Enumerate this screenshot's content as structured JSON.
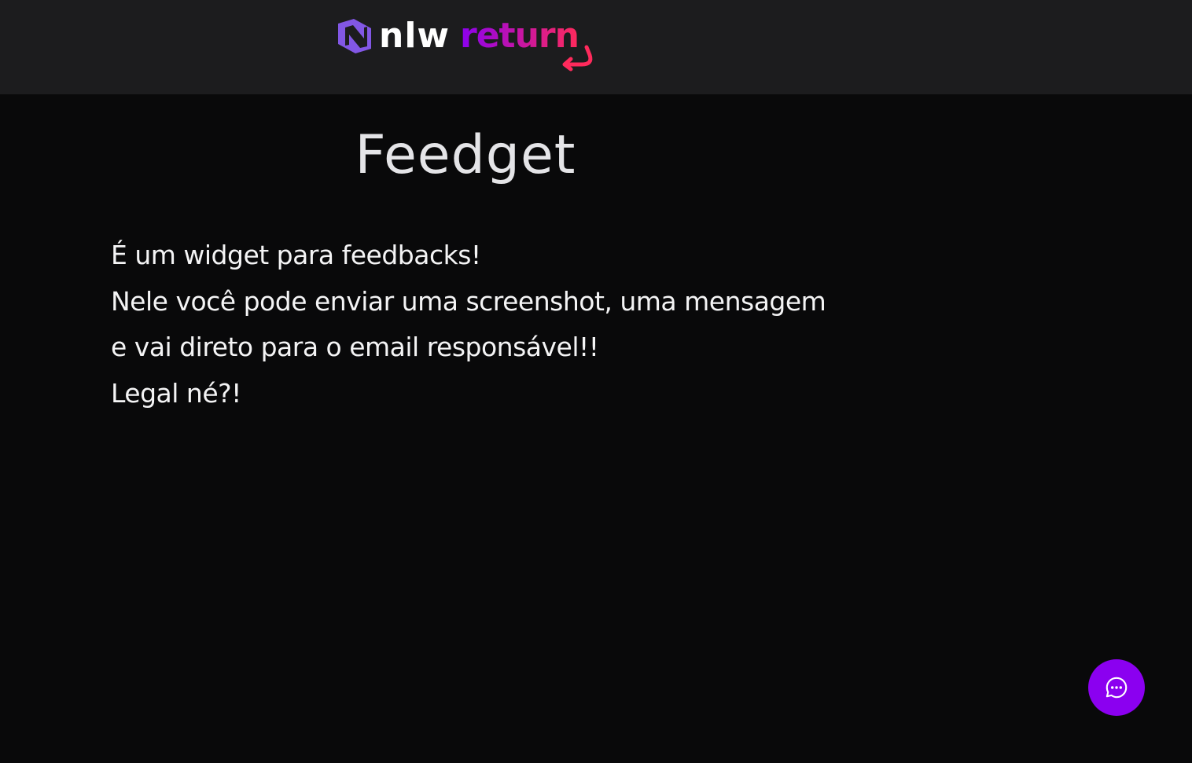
{
  "header": {
    "logo": {
      "text_primary": "nlw",
      "text_secondary": "return",
      "icon": "nlw-mark-icon",
      "colors": {
        "mark": "#8257e5",
        "primary_text": "#ffffff",
        "gradient_start": "#8b00f0",
        "gradient_end": "#ff2a5c"
      }
    },
    "background": "#1c1c1e"
  },
  "main": {
    "title": "Feedget",
    "description_lines": [
      "É um widget para feedbacks!",
      "Nele você pode enviar uma screenshot, uma mensagem",
      "e vai direto para o email responsável!!",
      "Legal né?!"
    ],
    "background": "#09090a"
  },
  "widget_button": {
    "icon": "chat-bubble-dots-icon",
    "color": "#8b00f0"
  }
}
